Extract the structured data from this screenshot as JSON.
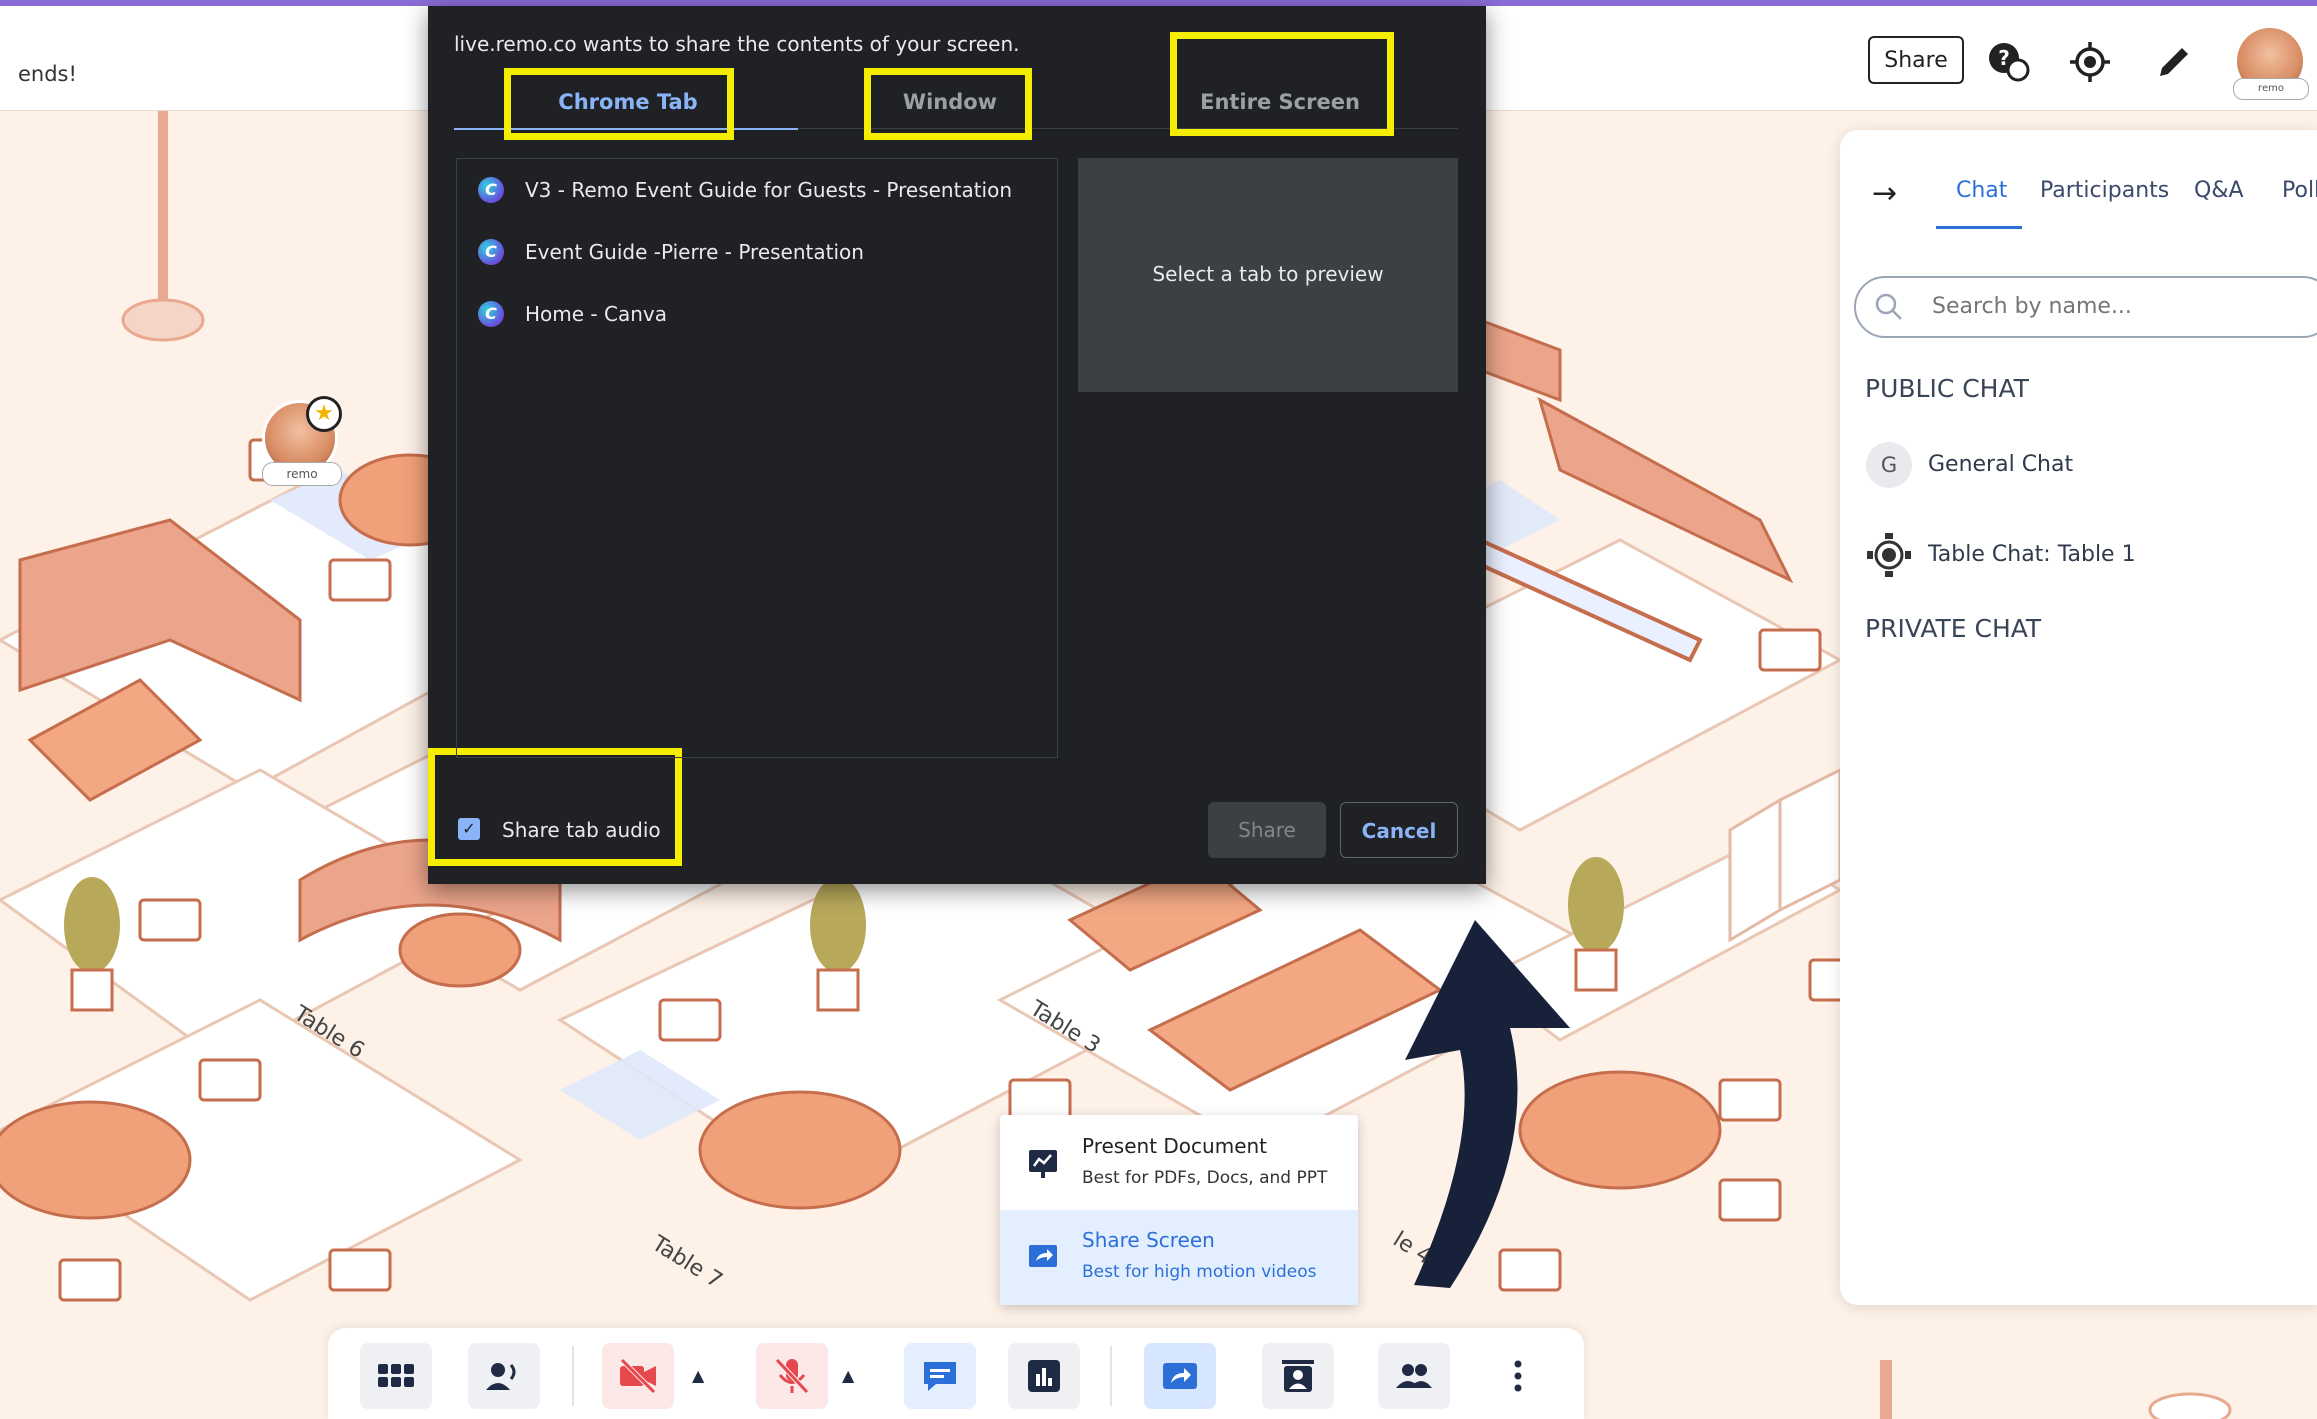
{
  "header": {
    "partial_text": "ends!",
    "share_button": "Share",
    "avatar_badge": "remo",
    "icons": [
      "help-icon",
      "locate-icon",
      "edit-icon"
    ]
  },
  "sidebar": {
    "tabs": [
      "Chat",
      "Participants",
      "Q&A",
      "Poll"
    ],
    "active_tab": "Chat",
    "search_placeholder": "Search by name...",
    "public_heading": "PUBLIC CHAT",
    "general_initial": "G",
    "general_chat": "General Chat",
    "table_chat": "Table Chat: Table 1",
    "private_heading": "PRIVATE CHAT"
  },
  "dialog": {
    "title": "live.remo.co wants to share the contents of your screen.",
    "tabs": [
      "Chrome Tab",
      "Window",
      "Entire Screen"
    ],
    "active_tab": "Chrome Tab",
    "items": [
      "V3 - Remo Event Guide for Guests - Presentation",
      "Event Guide -Pierre - Presentation",
      "Home - Canva"
    ],
    "item_icon_letter": "C",
    "preview_text": "Select a tab to preview",
    "audio_label": "Share tab audio",
    "audio_checked": true,
    "share_button": "Share",
    "cancel_button": "Cancel"
  },
  "map_labels": {
    "table6": "Table 6",
    "table3": "Table 3",
    "table7": "Table 7",
    "table4": "le 4",
    "avatar_badge": "remo"
  },
  "share_menu": {
    "present_title": "Present Document",
    "present_sub": "Best for PDFs, Docs, and PPT",
    "share_title": "Share Screen",
    "share_sub": "Best for high motion videos"
  },
  "toolbar": {
    "buttons": [
      "grid-icon",
      "talk-icon",
      "camera-off-icon",
      "mic-off-icon",
      "chat-icon",
      "stats-icon",
      "share-screen-icon",
      "stage-icon",
      "people-icon",
      "more-icon"
    ]
  },
  "colors": {
    "highlight": "#f5ee00",
    "accent": "#2d6fd8",
    "dialog_bg": "#202124",
    "arrow": "#17213a"
  }
}
